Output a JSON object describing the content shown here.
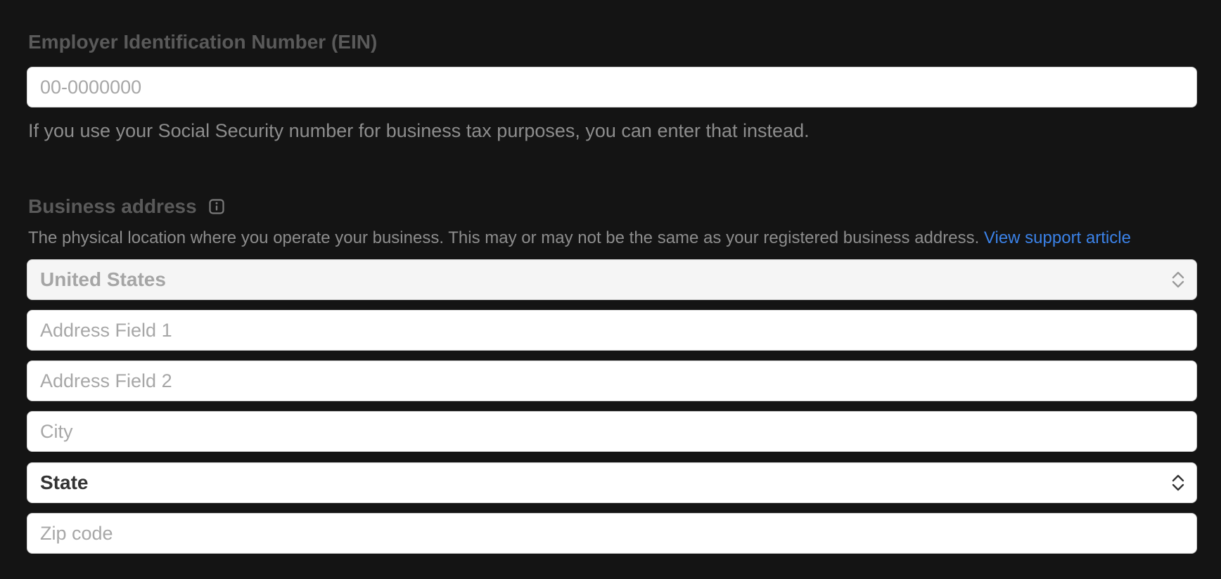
{
  "ein": {
    "label": "Employer Identification Number (EIN)",
    "placeholder": "00-0000000",
    "value": "",
    "helper": "If you use your Social Security number for business tax purposes, you can enter that instead."
  },
  "address": {
    "label": "Business address",
    "info_icon": "info-icon",
    "description": "The physical location where you operate your business. This may or may not be the same as your registered business address.",
    "support_link": "View support article",
    "country": {
      "selected": "United States",
      "icon": "chevron-up-down-icon"
    },
    "address1": {
      "placeholder": "Address Field 1"
    },
    "address2": {
      "placeholder": "Address Field 2"
    },
    "city": {
      "placeholder": "City"
    },
    "state": {
      "selected": "State",
      "icon": "chevron-up-down-icon"
    },
    "zip": {
      "placeholder": "Zip code"
    }
  },
  "colors": {
    "background": "#141414",
    "label": "#5a5a5a",
    "helper_text": "#8d8d8d",
    "link": "#3b82e8",
    "input_bg": "#ffffff",
    "input_border": "#cfcfcf",
    "disabled_bg": "#f5f5f5"
  }
}
